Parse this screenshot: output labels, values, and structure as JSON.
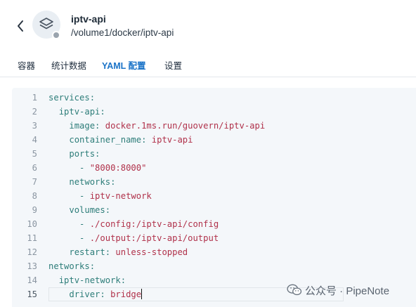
{
  "header": {
    "title": "iptv-api",
    "path": "/volume1/docker/iptv-api",
    "back_icon": "chevron-left-icon",
    "app_icon": "layers-icon",
    "status": "stopped"
  },
  "tabs": [
    {
      "label": "容器",
      "active": false
    },
    {
      "label": "统计数据",
      "active": false
    },
    {
      "label": "YAML 配置",
      "active": true
    },
    {
      "label": "设置",
      "active": false
    }
  ],
  "editor": {
    "lines": [
      {
        "n": "1",
        "indent": "",
        "key": "services",
        "sep": ":",
        "value": ""
      },
      {
        "n": "2",
        "indent": "  ",
        "key": "iptv-api",
        "sep": ":",
        "value": ""
      },
      {
        "n": "3",
        "indent": "    ",
        "key": "image",
        "sep": ": ",
        "value": "docker.1ms.run/guovern/iptv-api"
      },
      {
        "n": "4",
        "indent": "    ",
        "key": "container_name",
        "sep": ": ",
        "value": "iptv-api"
      },
      {
        "n": "5",
        "indent": "    ",
        "key": "ports",
        "sep": ":",
        "value": ""
      },
      {
        "n": "6",
        "indent": "      ",
        "key": "",
        "sep": "- ",
        "value": "\"8000:8000\""
      },
      {
        "n": "7",
        "indent": "    ",
        "key": "networks",
        "sep": ":",
        "value": ""
      },
      {
        "n": "8",
        "indent": "      ",
        "key": "",
        "sep": "- ",
        "value": "iptv-network"
      },
      {
        "n": "9",
        "indent": "    ",
        "key": "volumes",
        "sep": ":",
        "value": ""
      },
      {
        "n": "10",
        "indent": "      ",
        "key": "",
        "sep": "- ",
        "value": "./config:/iptv-api/config"
      },
      {
        "n": "11",
        "indent": "      ",
        "key": "",
        "sep": "- ",
        "value": "./output:/iptv-api/output"
      },
      {
        "n": "12",
        "indent": "    ",
        "key": "restart",
        "sep": ": ",
        "value": "unless-stopped"
      },
      {
        "n": "13",
        "indent": "",
        "key": "networks",
        "sep": ":",
        "value": ""
      },
      {
        "n": "14",
        "indent": "  ",
        "key": "iptv-network",
        "sep": ":",
        "value": ""
      },
      {
        "n": "15",
        "indent": "    ",
        "key": "driver",
        "sep": ": ",
        "value": "bridge",
        "current": true
      }
    ]
  },
  "watermark": {
    "text": "公众号 · PipeNote",
    "icon": "wechat-icon"
  },
  "colors": {
    "accent": "#1a73c8",
    "yaml_key": "#2d7d79",
    "yaml_value": "#b0314a",
    "editor_bg": "#f4f7fa"
  }
}
